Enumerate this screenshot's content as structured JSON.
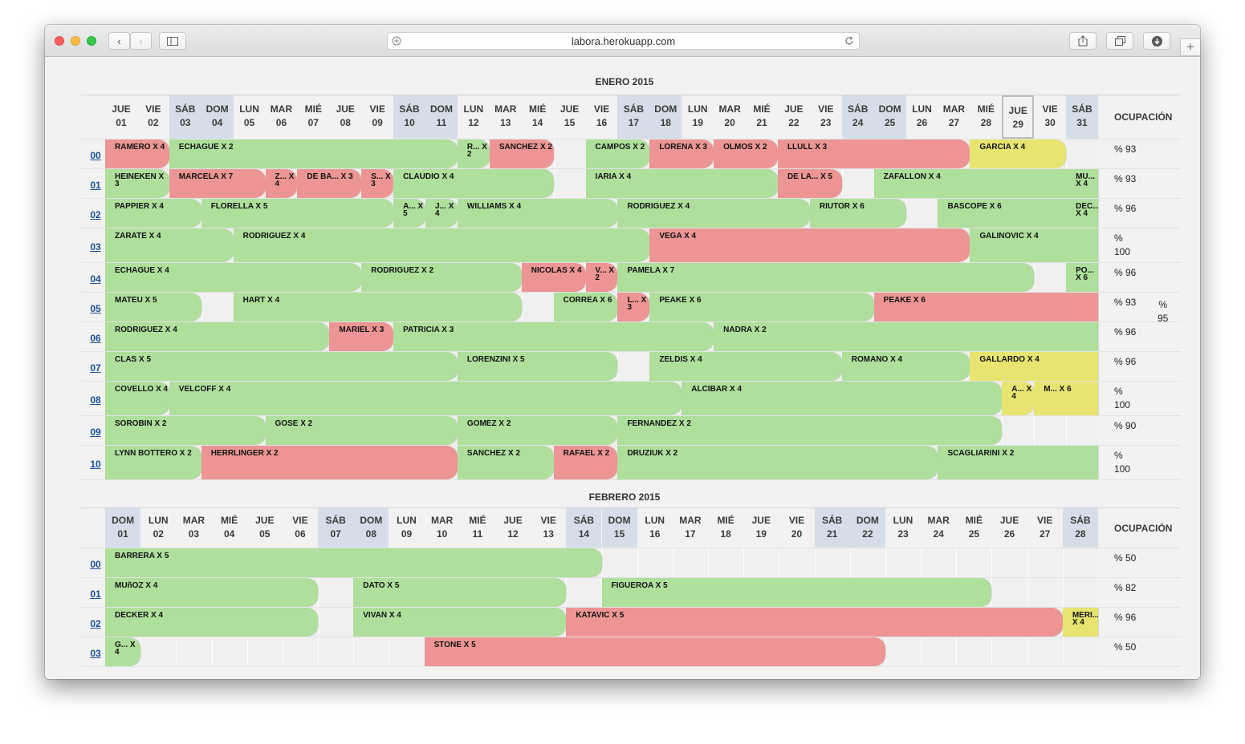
{
  "browser": {
    "url": "labora.herokuapp.com",
    "controls": [
      "back-icon",
      "forward-icon",
      "sidebar-icon",
      "share-icon",
      "tabs-icon",
      "download-icon",
      "new-tab-icon",
      "reload-icon"
    ]
  },
  "colors": {
    "occupied": "#aedf9b",
    "unpaid": "#ec9594",
    "reserved": "#e7e570",
    "weekend_header": "#d5dee8",
    "empty_cell": "#f0f0f0"
  },
  "occupancy_header": "OCUPACIÓN",
  "months": [
    {
      "title": "ENERO 2015",
      "today": 28,
      "days": [
        {
          "w": "JUE",
          "d": "01"
        },
        {
          "w": "VIE",
          "d": "02"
        },
        {
          "w": "SÁB",
          "d": "03",
          "we": 1
        },
        {
          "w": "DOM",
          "d": "04",
          "we": 1
        },
        {
          "w": "LUN",
          "d": "05"
        },
        {
          "w": "MAR",
          "d": "06"
        },
        {
          "w": "MIÉ",
          "d": "07"
        },
        {
          "w": "JUE",
          "d": "08"
        },
        {
          "w": "VIE",
          "d": "09"
        },
        {
          "w": "SÁB",
          "d": "10",
          "we": 1
        },
        {
          "w": "DOM",
          "d": "11",
          "we": 1
        },
        {
          "w": "LUN",
          "d": "12"
        },
        {
          "w": "MAR",
          "d": "13"
        },
        {
          "w": "MIÉ",
          "d": "14"
        },
        {
          "w": "JUE",
          "d": "15"
        },
        {
          "w": "VIE",
          "d": "16"
        },
        {
          "w": "SÁB",
          "d": "17",
          "we": 1
        },
        {
          "w": "DOM",
          "d": "18",
          "we": 1
        },
        {
          "w": "LUN",
          "d": "19"
        },
        {
          "w": "MAR",
          "d": "20"
        },
        {
          "w": "MIÉ",
          "d": "21"
        },
        {
          "w": "JUE",
          "d": "22"
        },
        {
          "w": "VIE",
          "d": "23"
        },
        {
          "w": "SÁB",
          "d": "24",
          "we": 1
        },
        {
          "w": "DOM",
          "d": "25",
          "we": 1
        },
        {
          "w": "LUN",
          "d": "26"
        },
        {
          "w": "MAR",
          "d": "27"
        },
        {
          "w": "MIÉ",
          "d": "28"
        },
        {
          "w": "JUE",
          "d": "29"
        },
        {
          "w": "VIE",
          "d": "30"
        },
        {
          "w": "SÁB",
          "d": "31",
          "we": 1
        }
      ],
      "month_occupancy": [
        "%",
        "95"
      ],
      "rows": [
        {
          "label": "00",
          "occ": "% 93",
          "bookings": [
            {
              "s": 0,
              "e": 2,
              "c": "r",
              "t": "RAMERO X 4"
            },
            {
              "s": 2,
              "e": 11,
              "c": "g",
              "t": "ECHAGUE X 2"
            },
            {
              "s": 11,
              "e": 12,
              "c": "g",
              "t": "R... X 2"
            },
            {
              "s": 12,
              "e": 14,
              "c": "r",
              "t": "SANCHEZ X 2"
            },
            {
              "s": 15,
              "e": 17,
              "c": "g",
              "t": "CAMPOS X 2"
            },
            {
              "s": 17,
              "e": 19,
              "c": "r",
              "t": "LORENA X 3"
            },
            {
              "s": 19,
              "e": 21,
              "c": "r",
              "t": "OLMOS X 2"
            },
            {
              "s": 21,
              "e": 27,
              "c": "r",
              "t": "LLULL X 3"
            },
            {
              "s": 27,
              "e": 30,
              "c": "y",
              "t": "GARCIA X 4"
            }
          ]
        },
        {
          "label": "01",
          "occ": "% 93",
          "bookings": [
            {
              "s": 0,
              "e": 2,
              "c": "g",
              "t": "HEINEKEN X 3"
            },
            {
              "s": 2,
              "e": 5,
              "c": "r",
              "t": "MARCELA X 7"
            },
            {
              "s": 5,
              "e": 6,
              "c": "r",
              "t": "Z... X 4"
            },
            {
              "s": 6,
              "e": 8,
              "c": "r",
              "t": "DE BA... X 3"
            },
            {
              "s": 8,
              "e": 9,
              "c": "r",
              "t": "S... X 3"
            },
            {
              "s": 9,
              "e": 14,
              "c": "g",
              "t": "CLAUDIO X 4"
            },
            {
              "s": 15,
              "e": 21,
              "c": "g",
              "t": "IARIA X 4"
            },
            {
              "s": 21,
              "e": 23,
              "c": "r",
              "t": "DE LA... X 5"
            },
            {
              "s": 24,
              "e": 30,
              "c": "g",
              "t": "ZAFALLON X 4",
              "sq": 1
            },
            {
              "s": 30,
              "e": 31,
              "c": "g",
              "t": "MU... X 4",
              "sq": 1
            }
          ]
        },
        {
          "label": "02",
          "occ": "% 96",
          "bookings": [
            {
              "s": 0,
              "e": 3,
              "c": "g",
              "t": "PAPPIER X 4"
            },
            {
              "s": 3,
              "e": 9,
              "c": "g",
              "t": "FLORELLA X 5"
            },
            {
              "s": 9,
              "e": 10,
              "c": "g",
              "t": "A... X 5"
            },
            {
              "s": 10,
              "e": 11,
              "c": "g",
              "t": "J... X 4"
            },
            {
              "s": 11,
              "e": 16,
              "c": "g",
              "t": "WILLIAMS X 4"
            },
            {
              "s": 16,
              "e": 22,
              "c": "g",
              "t": "RODRIGUEZ X 4"
            },
            {
              "s": 22,
              "e": 25,
              "c": "g",
              "t": "RIUTOR X 6"
            },
            {
              "s": 26,
              "e": 30,
              "c": "g",
              "t": "BASCOPE X 6",
              "sq": 1
            },
            {
              "s": 30,
              "e": 31,
              "c": "g",
              "t": "DEC... X 4",
              "sq": 1
            }
          ]
        },
        {
          "label": "03",
          "occ": "%\n100",
          "tall": 1,
          "bookings": [
            {
              "s": 0,
              "e": 4,
              "c": "g",
              "t": "ZARATE X 4"
            },
            {
              "s": 4,
              "e": 17,
              "c": "g",
              "t": "RODRIGUEZ X 4"
            },
            {
              "s": 17,
              "e": 27,
              "c": "r",
              "t": "VEGA X 4"
            },
            {
              "s": 27,
              "e": 31,
              "c": "g",
              "t": "GALINOVIC X 4",
              "sq": 1
            }
          ]
        },
        {
          "label": "04",
          "occ": "% 96",
          "bookings": [
            {
              "s": 0,
              "e": 8,
              "c": "g",
              "t": "ECHAGUE X 4"
            },
            {
              "s": 8,
              "e": 13,
              "c": "g",
              "t": "RODRIGUEZ X 2"
            },
            {
              "s": 13,
              "e": 15,
              "c": "r",
              "t": "NICOLAS X 4"
            },
            {
              "s": 15,
              "e": 16,
              "c": "r",
              "t": "V... X 2"
            },
            {
              "s": 16,
              "e": 29,
              "c": "g",
              "t": "PAMELA X 7"
            },
            {
              "s": 30,
              "e": 31,
              "c": "g",
              "t": "PO... X 6",
              "sq": 1
            }
          ]
        },
        {
          "label": "05",
          "occ": "% 93",
          "bookings": [
            {
              "s": 0,
              "e": 3,
              "c": "g",
              "t": "MATEU X 5"
            },
            {
              "s": 4,
              "e": 13,
              "c": "g",
              "t": "HART X 4"
            },
            {
              "s": 14,
              "e": 16,
              "c": "g",
              "t": "CORREA X 6"
            },
            {
              "s": 16,
              "e": 17,
              "c": "r",
              "t": "L... X 3"
            },
            {
              "s": 17,
              "e": 24,
              "c": "g",
              "t": "PEAKE X 6"
            },
            {
              "s": 24,
              "e": 31,
              "c": "r",
              "t": "PEAKE X 6",
              "sq": 1
            }
          ]
        },
        {
          "label": "06",
          "occ": "% 96",
          "bookings": [
            {
              "s": 0,
              "e": 7,
              "c": "g",
              "t": "RODRIGUEZ X 4"
            },
            {
              "s": 7,
              "e": 9,
              "c": "r",
              "t": "MARIEL X 3"
            },
            {
              "s": 9,
              "e": 19,
              "c": "g",
              "t": "PATRICIA X 3"
            },
            {
              "s": 19,
              "e": 31,
              "c": "g",
              "t": "NADRA X 2",
              "sq": 1
            }
          ]
        },
        {
          "label": "07",
          "occ": "% 96",
          "bookings": [
            {
              "s": 0,
              "e": 11,
              "c": "g",
              "t": "CLAS X 5"
            },
            {
              "s": 11,
              "e": 16,
              "c": "g",
              "t": "LORENZINI X 5"
            },
            {
              "s": 17,
              "e": 23,
              "c": "g",
              "t": "ZELDIS X 4"
            },
            {
              "s": 23,
              "e": 27,
              "c": "g",
              "t": "ROMANO X 4"
            },
            {
              "s": 27,
              "e": 31,
              "c": "y",
              "t": "GALLARDO X 4",
              "sq": 1
            }
          ]
        },
        {
          "label": "08",
          "occ": "%\n100",
          "tall": 1,
          "bookings": [
            {
              "s": 0,
              "e": 2,
              "c": "g",
              "t": "COVELLO X 4"
            },
            {
              "s": 2,
              "e": 18,
              "c": "g",
              "t": "VELCOFF X 4"
            },
            {
              "s": 18,
              "e": 28,
              "c": "g",
              "t": "ALCIBAR X 4"
            },
            {
              "s": 28,
              "e": 29,
              "c": "y",
              "t": "A... X 4"
            },
            {
              "s": 29,
              "e": 31,
              "c": "y",
              "t": "M... X 6",
              "sq": 1
            }
          ]
        },
        {
          "label": "09",
          "occ": "% 90",
          "bookings": [
            {
              "s": 0,
              "e": 5,
              "c": "g",
              "t": "SOROBIN X 2"
            },
            {
              "s": 5,
              "e": 11,
              "c": "g",
              "t": "GOSE X 2"
            },
            {
              "s": 11,
              "e": 16,
              "c": "g",
              "t": "GOMEZ X 2"
            },
            {
              "s": 16,
              "e": 28,
              "c": "g",
              "t": "FERNANDEZ X 2"
            }
          ]
        },
        {
          "label": "10",
          "occ": "%\n100",
          "tall": 1,
          "bookings": [
            {
              "s": 0,
              "e": 3,
              "c": "g",
              "t": "LYNN BOTTERO X 2"
            },
            {
              "s": 3,
              "e": 11,
              "c": "r",
              "t": "HERRLINGER X 2"
            },
            {
              "s": 11,
              "e": 14,
              "c": "g",
              "t": "SANCHEZ X 2"
            },
            {
              "s": 14,
              "e": 16,
              "c": "r",
              "t": "RAFAEL X 2"
            },
            {
              "s": 16,
              "e": 26,
              "c": "g",
              "t": "DRUZIUK X 2"
            },
            {
              "s": 26,
              "e": 31,
              "c": "g",
              "t": "SCAGLIARINI X 2",
              "sq": 1
            }
          ]
        }
      ]
    },
    {
      "title": "FEBRERO 2015",
      "today": -1,
      "days": [
        {
          "w": "DOM",
          "d": "01",
          "we": 1
        },
        {
          "w": "LUN",
          "d": "02"
        },
        {
          "w": "MAR",
          "d": "03"
        },
        {
          "w": "MIÉ",
          "d": "04"
        },
        {
          "w": "JUE",
          "d": "05"
        },
        {
          "w": "VIE",
          "d": "06"
        },
        {
          "w": "SÁB",
          "d": "07",
          "we": 1
        },
        {
          "w": "DOM",
          "d": "08",
          "we": 1
        },
        {
          "w": "LUN",
          "d": "09"
        },
        {
          "w": "MAR",
          "d": "10"
        },
        {
          "w": "MIÉ",
          "d": "11"
        },
        {
          "w": "JUE",
          "d": "12"
        },
        {
          "w": "VIE",
          "d": "13"
        },
        {
          "w": "SÁB",
          "d": "14",
          "we": 1
        },
        {
          "w": "DOM",
          "d": "15",
          "we": 1
        },
        {
          "w": "LUN",
          "d": "16"
        },
        {
          "w": "MAR",
          "d": "17"
        },
        {
          "w": "MIÉ",
          "d": "18"
        },
        {
          "w": "JUE",
          "d": "19"
        },
        {
          "w": "VIE",
          "d": "20"
        },
        {
          "w": "SÁB",
          "d": "21",
          "we": 1
        },
        {
          "w": "DOM",
          "d": "22",
          "we": 1
        },
        {
          "w": "LUN",
          "d": "23"
        },
        {
          "w": "MAR",
          "d": "24"
        },
        {
          "w": "MIÉ",
          "d": "25"
        },
        {
          "w": "JUE",
          "d": "26"
        },
        {
          "w": "VIE",
          "d": "27"
        },
        {
          "w": "SÁB",
          "d": "28",
          "we": 1
        }
      ],
      "rows": [
        {
          "label": "00",
          "occ": "% 50",
          "bookings": [
            {
              "s": 0,
              "e": 14,
              "c": "g",
              "t": "BARRERA X 5"
            }
          ]
        },
        {
          "label": "01",
          "occ": "% 82",
          "bookings": [
            {
              "s": 0,
              "e": 6,
              "c": "g",
              "t": "MUñOZ X 4"
            },
            {
              "s": 7,
              "e": 13,
              "c": "g",
              "t": "DATO X 5"
            },
            {
              "s": 14,
              "e": 25,
              "c": "g",
              "t": "FIGUEROA X 5"
            }
          ]
        },
        {
          "label": "02",
          "occ": "% 96",
          "bookings": [
            {
              "s": 0,
              "e": 6,
              "c": "g",
              "t": "DECKER X 4"
            },
            {
              "s": 7,
              "e": 13,
              "c": "g",
              "t": "VIVAN X 4"
            },
            {
              "s": 13,
              "e": 27,
              "c": "r",
              "t": "KATAVIC X 5"
            },
            {
              "s": 27,
              "e": 28,
              "c": "y",
              "t": "MERI... X 4",
              "sq": 1
            }
          ]
        },
        {
          "label": "03",
          "occ": "% 50",
          "bookings": [
            {
              "s": 0,
              "e": 1,
              "c": "g",
              "t": "G... X 4"
            },
            {
              "s": 9,
              "e": 22,
              "c": "r",
              "t": "STONE X 5"
            }
          ]
        }
      ]
    }
  ]
}
